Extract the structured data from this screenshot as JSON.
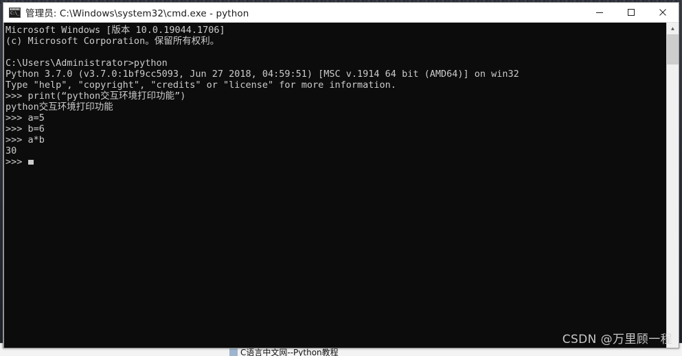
{
  "window": {
    "title": "管理员: C:\\Windows\\system32\\cmd.exe - python",
    "icon": "cmd-console-icon",
    "controls": {
      "minimize": "最小化",
      "maximize": "最大化",
      "close": "关闭"
    }
  },
  "console": {
    "background_color": "#0c0c0c",
    "text_color": "#cccccc",
    "lines": [
      "Microsoft Windows [版本 10.0.19044.1706]",
      "(c) Microsoft Corporation。保留所有权利。",
      "",
      "C:\\Users\\Administrator>python",
      "Python 3.7.0 (v3.7.0:1bf9cc5093, Jun 27 2018, 04:59:51) [MSC v.1914 64 bit (AMD64)] on win32",
      "Type \"help\", \"copyright\", \"credits\" or \"license\" for more information.",
      ">>> print(“python交互环境打印功能”)",
      "python交互环境打印功能",
      ">>> a=5",
      ">>> b=6",
      ">>> a*b",
      "30"
    ],
    "prompt": ">>> ",
    "cursor": "block-cursor"
  },
  "scrollbar": {
    "up_arrow": "▲",
    "down_arrow": "▼",
    "thumb": "scroll-thumb"
  },
  "taskbar": {
    "item_label": "C语言中文网--Python教程"
  },
  "watermark": {
    "text": "CSDN @万里顾一程"
  }
}
